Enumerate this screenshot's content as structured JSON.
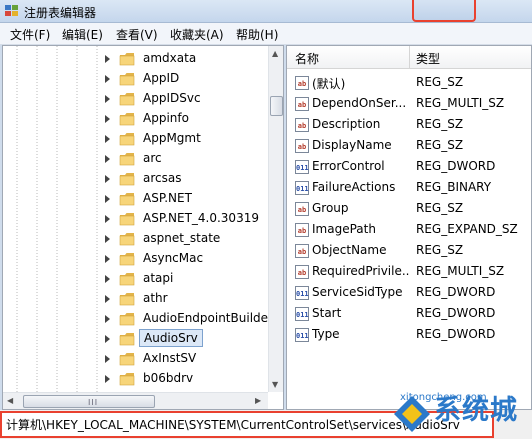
{
  "window": {
    "title": "注册表编辑器"
  },
  "menu": [
    "文件(F)",
    "编辑(E)",
    "查看(V)",
    "收藏夹(A)",
    "帮助(H)"
  ],
  "tree": {
    "items": [
      {
        "label": "amdxata",
        "selected": false
      },
      {
        "label": "AppID",
        "selected": false
      },
      {
        "label": "AppIDSvc",
        "selected": false
      },
      {
        "label": "Appinfo",
        "selected": false
      },
      {
        "label": "AppMgmt",
        "selected": false
      },
      {
        "label": "arc",
        "selected": false
      },
      {
        "label": "arcsas",
        "selected": false
      },
      {
        "label": "ASP.NET",
        "selected": false
      },
      {
        "label": "ASP.NET_4.0.30319",
        "selected": false
      },
      {
        "label": "aspnet_state",
        "selected": false
      },
      {
        "label": "AsyncMac",
        "selected": false
      },
      {
        "label": "atapi",
        "selected": false
      },
      {
        "label": "athr",
        "selected": false
      },
      {
        "label": "AudioEndpointBuilde",
        "selected": false
      },
      {
        "label": "AudioSrv",
        "selected": true
      },
      {
        "label": "AxInstSV",
        "selected": false
      },
      {
        "label": "b06bdrv",
        "selected": false
      }
    ],
    "scroll_grip": "III"
  },
  "values": {
    "columns": {
      "name": "名称",
      "type": "类型"
    },
    "rows": [
      {
        "name": "(默认)",
        "type": "REG_SZ",
        "icon": "string-value-icon"
      },
      {
        "name": "DependOnSer...",
        "type": "REG_MULTI_SZ",
        "icon": "string-value-icon"
      },
      {
        "name": "Description",
        "type": "REG_SZ",
        "icon": "string-value-icon"
      },
      {
        "name": "DisplayName",
        "type": "REG_SZ",
        "icon": "string-value-icon"
      },
      {
        "name": "ErrorControl",
        "type": "REG_DWORD",
        "icon": "binary-value-icon"
      },
      {
        "name": "FailureActions",
        "type": "REG_BINARY",
        "icon": "binary-value-icon"
      },
      {
        "name": "Group",
        "type": "REG_SZ",
        "icon": "string-value-icon"
      },
      {
        "name": "ImagePath",
        "type": "REG_EXPAND_SZ",
        "icon": "string-value-icon"
      },
      {
        "name": "ObjectName",
        "type": "REG_SZ",
        "icon": "string-value-icon"
      },
      {
        "name": "RequiredPrivile...",
        "type": "REG_MULTI_SZ",
        "icon": "string-value-icon"
      },
      {
        "name": "ServiceSidType",
        "type": "REG_DWORD",
        "icon": "binary-value-icon"
      },
      {
        "name": "Start",
        "type": "REG_DWORD",
        "icon": "binary-value-icon"
      },
      {
        "name": "Type",
        "type": "REG_DWORD",
        "icon": "binary-value-icon"
      }
    ]
  },
  "status": {
    "path": "计算机\\HKEY_LOCAL_MACHINE\\SYSTEM\\CurrentControlSet\\services\\AudioSrv"
  },
  "watermark": {
    "text": "系统城",
    "url": "xitongcheng.com"
  },
  "colors": {
    "highlight": "#e9412f",
    "selection": "#dce8f7",
    "folder": "#f2c75c",
    "watermark": "#2b79c9"
  }
}
